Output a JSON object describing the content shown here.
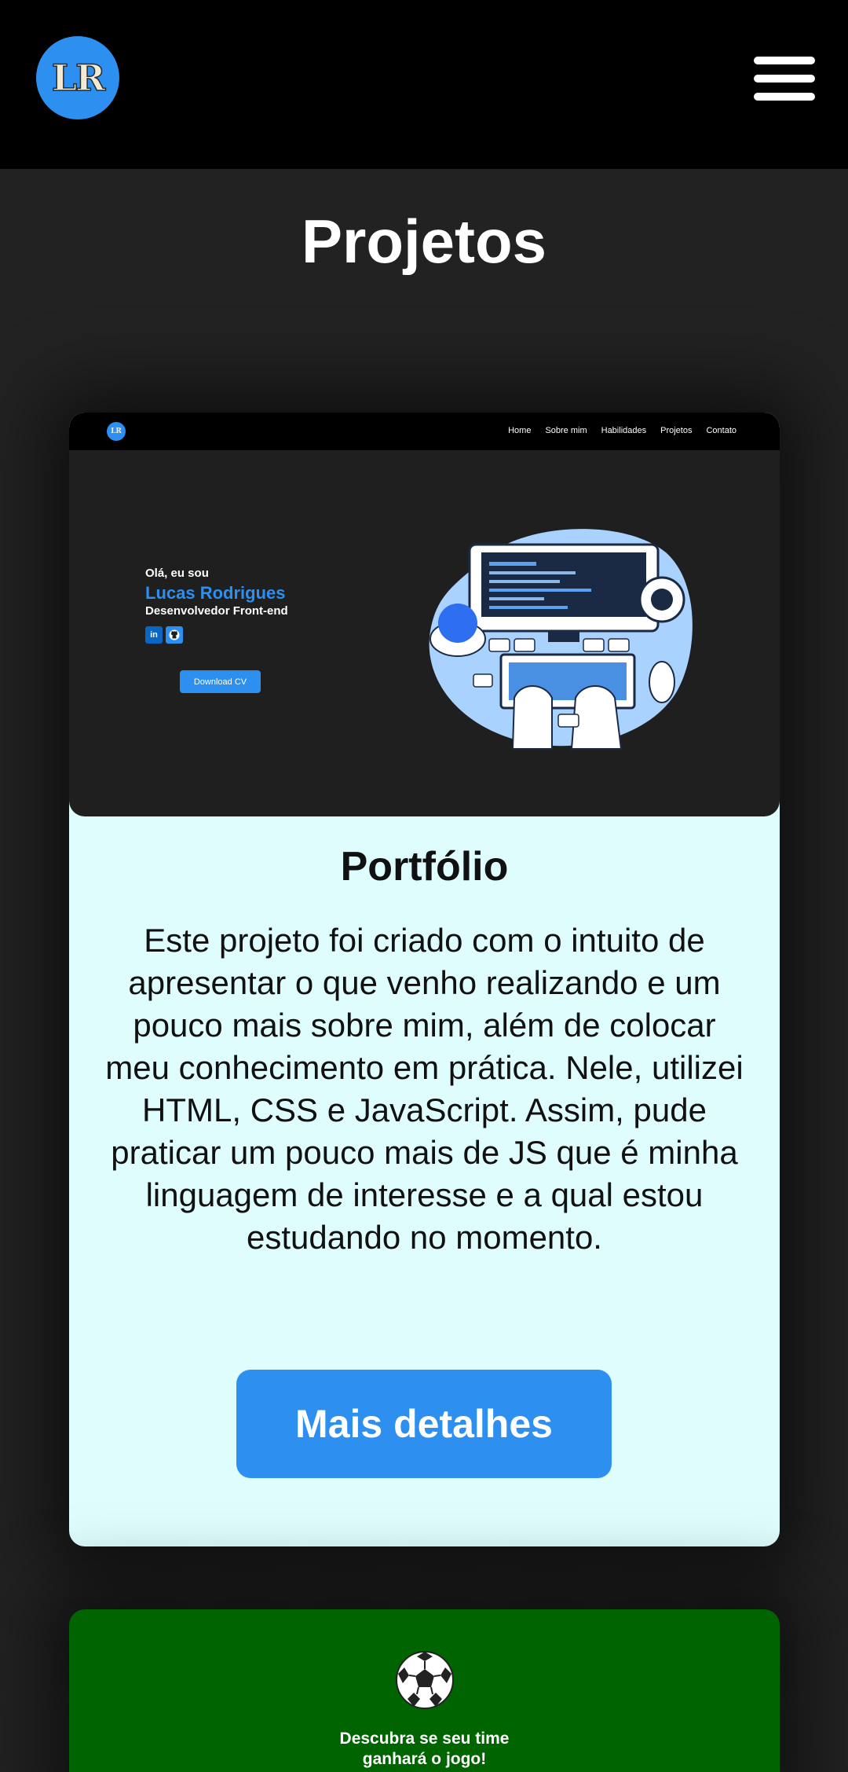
{
  "header": {
    "logo_text": "LR",
    "menu_icon": "hamburger-menu-icon"
  },
  "section": {
    "title": "Projetos"
  },
  "projects": [
    {
      "screenshot": {
        "logo_text": "LR",
        "nav_links": [
          "Home",
          "Sobre mim",
          "Habilidades",
          "Projetos",
          "Contato"
        ],
        "greeting": "Olá, eu sou",
        "name": "Lucas Rodrigues",
        "role": "Desenvolvedor Front-end",
        "social_icons": [
          "linkedin-icon",
          "github-icon"
        ],
        "cv_button": "Download CV"
      },
      "title": "Portfólio",
      "description": "Este projeto foi criado com o intuito de apresentar o que venho realizando e um pouco mais sobre mim, além de colocar meu conhecimento em prática. Nele, utilizei HTML, CSS e JavaScript. Assim, pude praticar um pouco mais de JS que é minha linguagem de interesse e a qual estou estudando no momento.",
      "button_label": "Mais detalhes"
    },
    {
      "icon": "soccer-ball-icon",
      "preview_text_line1": "Descubra se seu time",
      "preview_text_line2": "ganhará o jogo!"
    }
  ],
  "colors": {
    "accent": "#2d8ff0",
    "page_bg": "#222222",
    "card_bg": "#dffdfd",
    "card2_bg": "#006400"
  }
}
